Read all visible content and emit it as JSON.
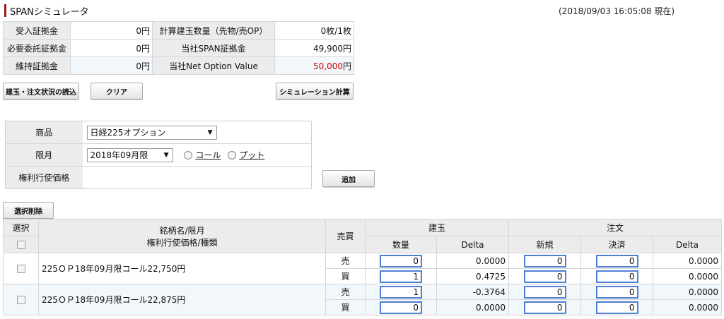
{
  "header": {
    "title": "SPANシミュレータ",
    "timestamp": "(2018/09/03 16:05:08 現在)"
  },
  "summary": {
    "rows": [
      {
        "label1": "受入証拠金",
        "value1": "0円",
        "label2": "計算建玉数量（先物/売OP）",
        "value2": "0枚/1枚"
      },
      {
        "label1": "必要委託証拠金",
        "value1": "0円",
        "label2": "当社SPAN証拠金",
        "value2": "49,900円"
      },
      {
        "label1": "維持証拠金",
        "value1": "0円",
        "label2": "当社Net Option Value",
        "value2": "50,000",
        "value2_unit": "円"
      }
    ],
    "nov_color": "#cc0000"
  },
  "buttons": {
    "load": "建玉・注文状況の読込",
    "clear": "クリア",
    "simulate": "シミュレーション計算",
    "add": "追加",
    "delete_selected": "選択削除"
  },
  "form": {
    "product_label": "商品",
    "product_value": "日経225オプション",
    "month_label": "限月",
    "month_value": "2018年09月限",
    "call_label": "コール",
    "put_label": "プット",
    "strike_label": "権利行使価格"
  },
  "positions": {
    "headers": {
      "select": "選択",
      "name_line1": "銘柄名/限月",
      "name_line2": "権利行使価格/種類",
      "side": "売買",
      "position": "建玉",
      "order": "注文",
      "qty": "数量",
      "delta": "Delta",
      "new": "新規",
      "settle": "決済",
      "order_delta": "Delta"
    },
    "rows": [
      {
        "name": "225ＯＰ18年09月限コール22,750円",
        "sell": {
          "side": "売",
          "qty": "0",
          "delta": "0.0000",
          "new": "0",
          "settle": "0",
          "order_delta": "0.0000"
        },
        "buy": {
          "side": "買",
          "qty": "1",
          "delta": "0.4725",
          "new": "0",
          "settle": "0",
          "order_delta": "0.0000"
        }
      },
      {
        "name": "225ＯＰ18年09月限コール22,875円",
        "sell": {
          "side": "売",
          "qty": "1",
          "delta": "-0.3764",
          "new": "0",
          "settle": "0",
          "order_delta": "0.0000"
        },
        "buy": {
          "side": "買",
          "qty": "0",
          "delta": "0.0000",
          "new": "0",
          "settle": "0",
          "order_delta": "0.0000"
        }
      }
    ]
  }
}
